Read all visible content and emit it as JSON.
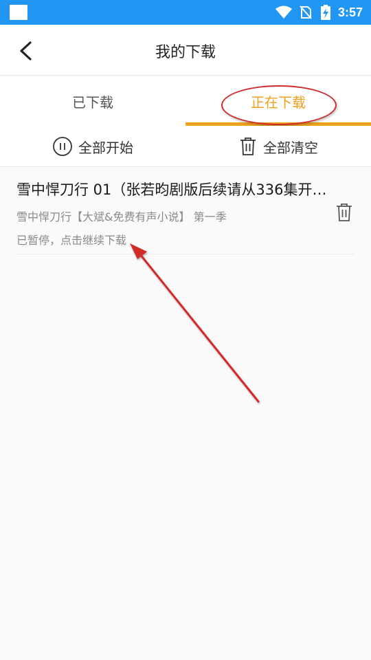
{
  "status_bar": {
    "time": "3:57"
  },
  "header": {
    "title": "我的下载"
  },
  "tabs": [
    {
      "label": "已下载",
      "active": false
    },
    {
      "label": "正在下载",
      "active": true
    }
  ],
  "actions": {
    "start_all": "全部开始",
    "clear_all": "全部清空"
  },
  "downloads": [
    {
      "title": "雪中悍刀行 01（张若昀剧版后续请从336集开…",
      "subtitle": "雪中悍刀行【大斌&免费有声小说】 第一季",
      "status": "已暂停，点击继续下载"
    }
  ],
  "colors": {
    "status_bar": "#2196f3",
    "accent": "#f0a01e",
    "annotation": "#d12a2a"
  }
}
